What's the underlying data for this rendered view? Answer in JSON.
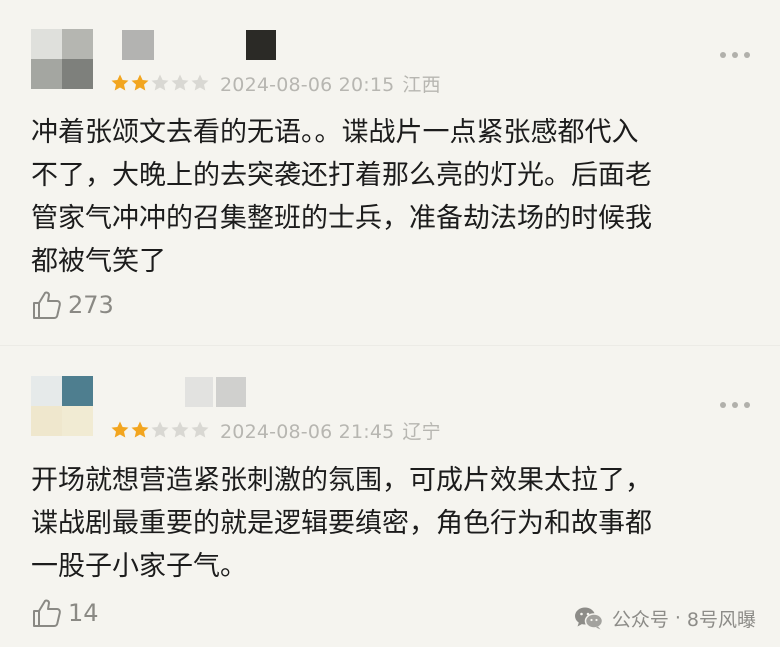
{
  "reviews": [
    {
      "avatar_colors": [
        "#dfe0dc",
        "#b5b6b1",
        "#a4a6a1",
        "#7e807c"
      ],
      "rating": 2,
      "max_rating": 5,
      "date": "2024-08-06 20:15",
      "location": "江西",
      "text_lines": [
        "冲着张颂文去看的无语。。谍战片一点紧张感都代入",
        "不了，大晚上的去突袭还打着那么亮的灯光。后面老",
        "管家气冲冲的召集整班的士兵，准备劫法场的时候我",
        "都被气笑了"
      ],
      "likes": "273"
    },
    {
      "avatar_colors": [
        "#e6eaea",
        "#4e7e8f",
        "#efe7cd",
        "#f1ebd3"
      ],
      "rating": 2,
      "max_rating": 5,
      "date": "2024-08-06 21:45",
      "location": "辽宁",
      "text_lines": [
        "开场就想营造紧张刺激的氛围，可成片效果太拉了，",
        "谍战剧最重要的就是逻辑要缜密，角色行为和故事都",
        "一股子小家子气。"
      ],
      "likes": "14"
    }
  ],
  "colors": {
    "background": "#f5f4ef",
    "star_filled": "#f2a51f",
    "star_empty": "#d9d8d3",
    "meta_text": "#b7b6b1",
    "body_text": "#1c1c1c"
  },
  "icons": {
    "more": "more-dots-icon",
    "like": "thumbs-up-icon",
    "watermark": "wechat-icon"
  },
  "watermark": {
    "platform": "公众号",
    "separator": "·",
    "account": "8号风曝"
  }
}
